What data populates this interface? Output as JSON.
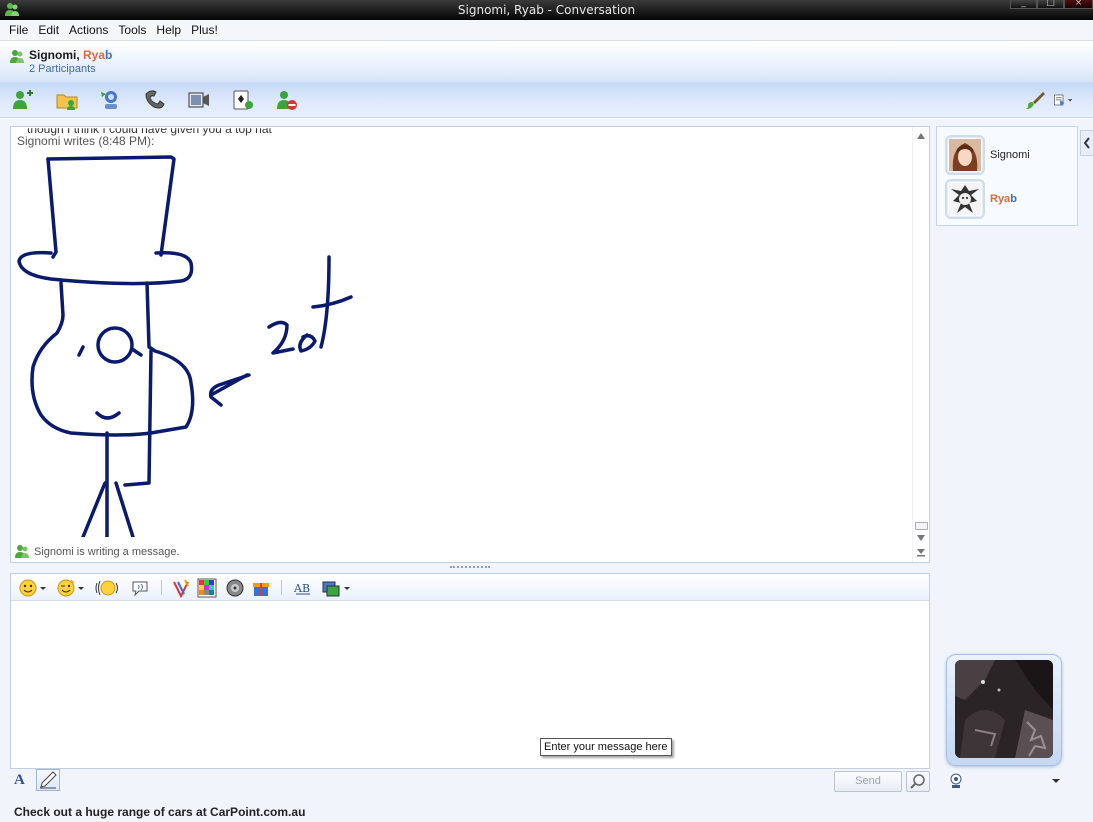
{
  "window": {
    "title": "Signomi, Ryab - Conversation"
  },
  "menu": [
    "File",
    "Edit",
    "Actions",
    "Tools",
    "Help",
    "Plus!"
  ],
  "header": {
    "name_1": "Signomi,",
    "name_2_part1": "Rya",
    "name_2_part2": "b",
    "participants": "2 Participants"
  },
  "toolbar": {
    "buttons": [
      "invite-contact-icon",
      "send-files-icon",
      "webcam-share-icon",
      "voice-call-icon",
      "video-call-icon",
      "games-icon",
      "block-contact-icon"
    ],
    "right_buttons": [
      "paint-brush-icon",
      "show-menu-icon"
    ]
  },
  "conversation": {
    "cut_off_line": "though I think I could have given you a top hat",
    "writes_line": "Signomi writes (8:48 PM):",
    "status": "Signomi is writing a message."
  },
  "format_bar": {
    "buttons": [
      "emoticon-icon",
      "wink-icon",
      "nudge-icon",
      "voice-clip-icon",
      "font-icon",
      "background-icon",
      "sound-icon",
      "gift-icon",
      "handwriting-icon",
      "change-display-icon"
    ]
  },
  "input": {
    "tooltip": "Enter your message here",
    "send_label": "Send"
  },
  "ad_text": "Check out a huge range of cars at CarPoint.com.au",
  "participants": [
    {
      "name": "Signomi"
    },
    {
      "name_part1": "Rya",
      "name_part2": "b"
    }
  ],
  "colors": {
    "accent_orange": "#e2693a",
    "accent_blue": "#3a6fd6",
    "ink": "#0a1a6e"
  }
}
